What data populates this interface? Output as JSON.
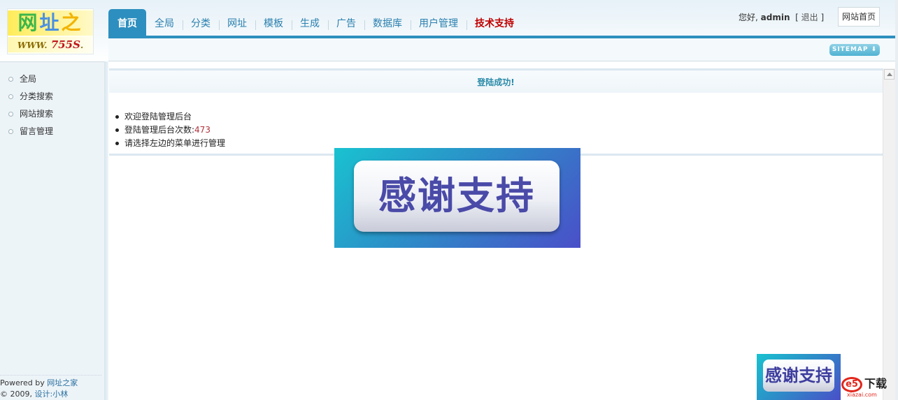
{
  "logo": {
    "chars": [
      "网",
      "址",
      "之"
    ],
    "www": "WWW.",
    "brand": "755S",
    "dot": "."
  },
  "nav": {
    "items": [
      {
        "label": "首页",
        "active": true
      },
      {
        "label": "全局"
      },
      {
        "label": "分类"
      },
      {
        "label": "网址"
      },
      {
        "label": "模板"
      },
      {
        "label": "生成"
      },
      {
        "label": "广告"
      },
      {
        "label": "数据库"
      },
      {
        "label": "用户管理"
      },
      {
        "label": "技术支持",
        "highlight": true
      }
    ]
  },
  "user": {
    "greeting": "您好,",
    "name": "admin",
    "bracket_open": "[",
    "logout": "退出",
    "bracket_close": "]",
    "home_button": "网站首页"
  },
  "subbar": {
    "sitemap": "SITEMAP ⬇"
  },
  "sidebar": {
    "items": [
      {
        "label": "全局"
      },
      {
        "label": "分类搜索"
      },
      {
        "label": "网站搜索"
      },
      {
        "label": "留言管理"
      }
    ],
    "footer": {
      "powered_by": "Powered by",
      "powered_link": "网址之家",
      "copyright": "© 2009,",
      "design_link": "设计:小林"
    }
  },
  "main": {
    "success_title": "登陆成功!",
    "welcome": "欢迎登陆管理后台",
    "login_count_label": "登陆管理后台次数:",
    "login_count": "473",
    "hint": "请选择左边的菜单进行管理"
  },
  "banners": {
    "big_text": "感谢支持",
    "small_text": "感谢支持"
  },
  "watermark": {
    "logo": "e5",
    "text": "下载",
    "url": "xiazai.com"
  },
  "colors": {
    "accent": "#2d8fbf",
    "support": "#c00000",
    "success": "#2a8aa8",
    "count": "#b0333c"
  }
}
